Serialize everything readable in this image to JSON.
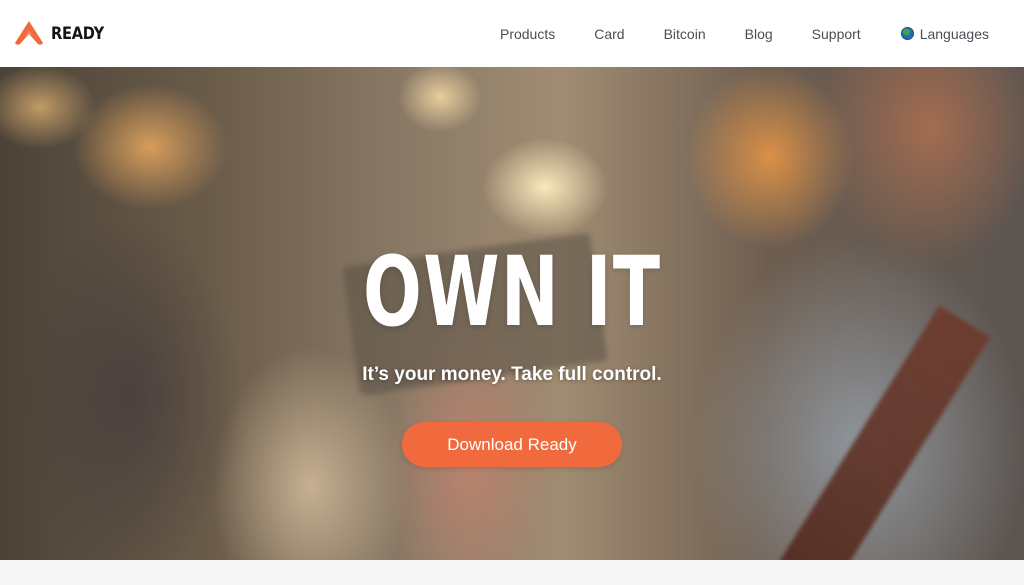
{
  "brand": {
    "name": "READY",
    "logo_color": "#f06a3e"
  },
  "nav": {
    "links": [
      "Products",
      "Card",
      "Bitcoin",
      "Blog",
      "Support"
    ],
    "languages_label": "Languages",
    "languages_icon": "globe-icon"
  },
  "hero": {
    "title": "OWN IT",
    "subtitle": "It’s your money. Take full control.",
    "cta_label": "Download Ready",
    "cta_color": "#f06a3e"
  }
}
